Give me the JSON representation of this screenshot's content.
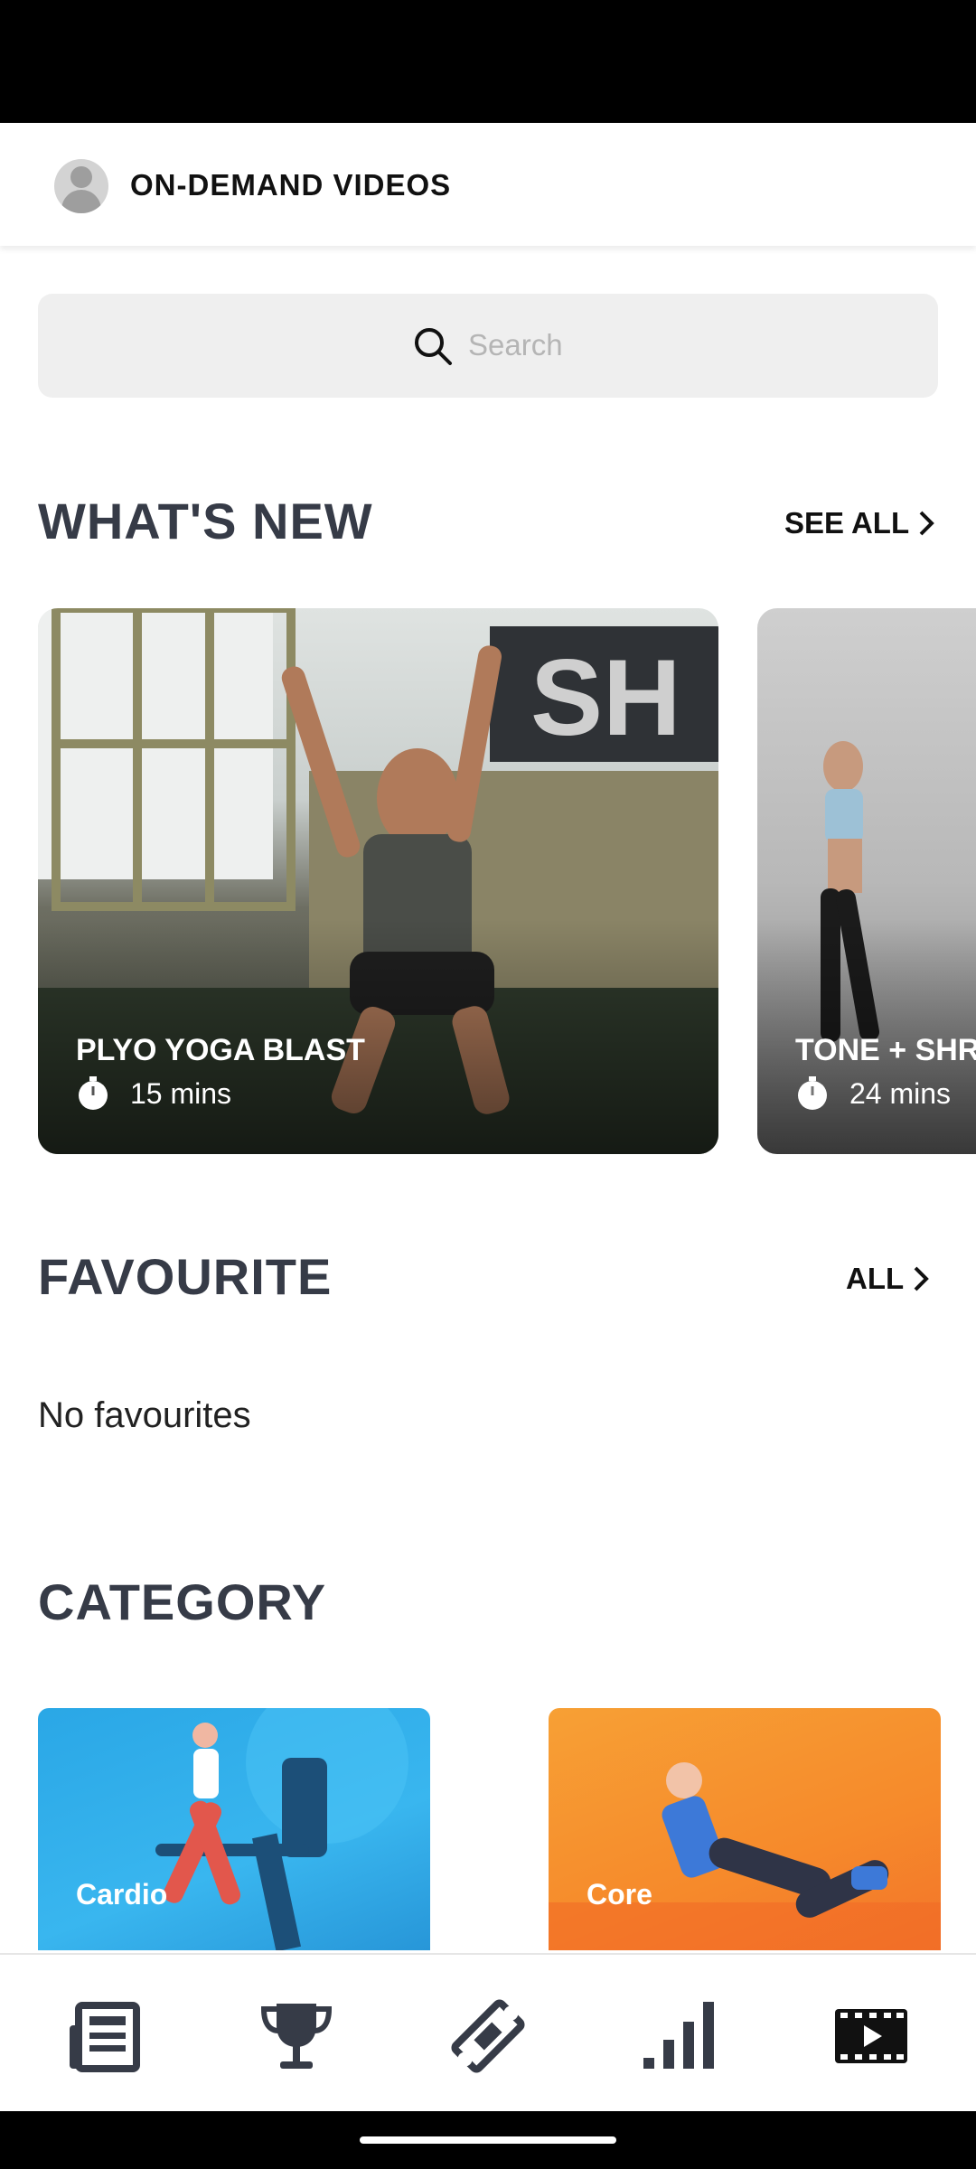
{
  "header": {
    "title": "ON-DEMAND VIDEOS"
  },
  "search": {
    "placeholder": "Search"
  },
  "whats_new": {
    "title": "WHAT'S NEW",
    "link_label": "SEE ALL",
    "videos": [
      {
        "title": "PLYO YOGA BLAST",
        "duration": "15 mins"
      },
      {
        "title": "TONE + SHRE",
        "duration": "24 mins"
      }
    ]
  },
  "favourite": {
    "title": "FAVOURITE",
    "link_label": "ALL",
    "empty_text": "No favourites"
  },
  "category": {
    "title": "CATEGORY",
    "items": [
      {
        "label": "Cardio",
        "color": "#2aa7e6"
      },
      {
        "label": "Core",
        "color": "#f68a2b"
      }
    ]
  },
  "bottom_nav": {
    "items": [
      {
        "icon": "newspaper-icon"
      },
      {
        "icon": "trophy-icon"
      },
      {
        "icon": "ticket-icon"
      },
      {
        "icon": "bar-chart-icon"
      },
      {
        "icon": "film-play-icon",
        "active": true
      }
    ]
  },
  "colors": {
    "heading": "#363b47",
    "search_bg": "#efefef"
  }
}
